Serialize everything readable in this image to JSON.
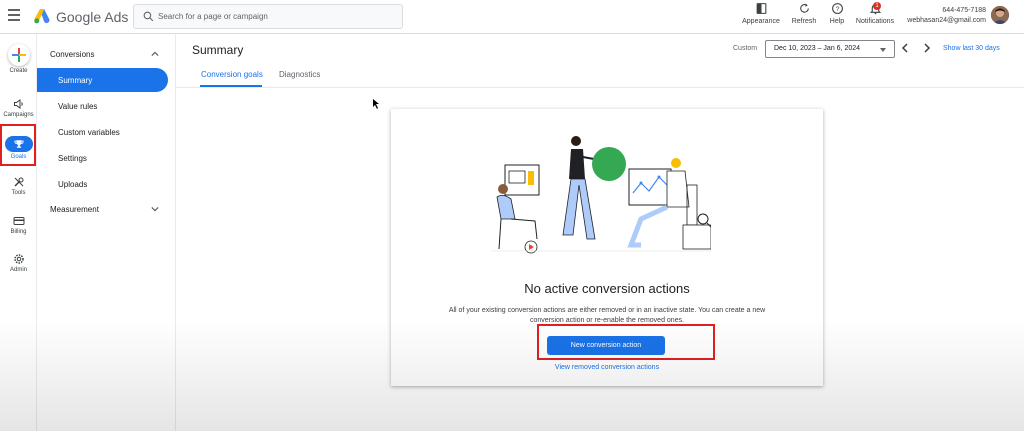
{
  "app": {
    "title": "Google Ads"
  },
  "search": {
    "placeholder": "Search for a page or campaign"
  },
  "toolbar": {
    "appearance": "Appearance",
    "refresh": "Refresh",
    "help": "Help",
    "notifications": "Notifications",
    "notification_count": "1"
  },
  "account": {
    "id": "644-475-7188",
    "email": "webhasan24@gmail.com"
  },
  "rail": {
    "create": "Create",
    "campaigns": "Campaigns",
    "goals": "Goals",
    "tools": "Tools",
    "billing": "Billing",
    "admin": "Admin"
  },
  "subnav": {
    "conversions": "Conversions",
    "items": [
      "Summary",
      "Value rules",
      "Custom variables",
      "Settings",
      "Uploads"
    ],
    "measurement": "Measurement"
  },
  "main": {
    "title": "Summary",
    "date_label": "Custom",
    "date_range": "Dec 10, 2023 – Jan 6, 2024",
    "show_last": "Show last 30 days",
    "tabs": [
      "Conversion goals",
      "Diagnostics"
    ]
  },
  "card": {
    "title": "No active conversion actions",
    "description": "All of your existing conversion actions are either removed or in an inactive state. You can create a new conversion action or re-enable the removed ones.",
    "button": "New conversion action",
    "link": "View removed conversion actions"
  },
  "colors": {
    "accent": "#1a73e8",
    "highlight": "#e02020"
  }
}
